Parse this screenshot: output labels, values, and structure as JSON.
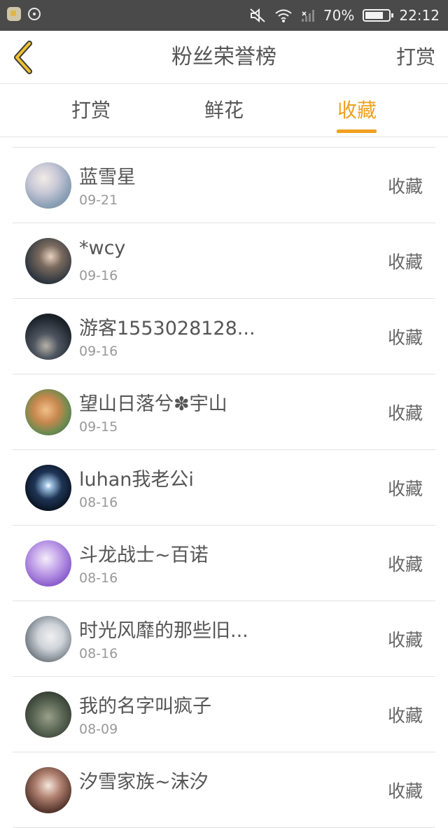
{
  "status_bar": {
    "battery": "70%",
    "time": "22:12"
  },
  "header": {
    "title": "粉丝荣誉榜",
    "action_label": "打赏"
  },
  "tabs": [
    {
      "label": "打赏",
      "active": false
    },
    {
      "label": "鲜花",
      "active": false
    },
    {
      "label": "收藏",
      "active": true
    }
  ],
  "accent_color": "#f0a020",
  "fans": [
    {
      "name": "蓝雪星",
      "date": "09-21",
      "action": "收藏"
    },
    {
      "name": "*wcy",
      "date": "09-16",
      "action": "收藏"
    },
    {
      "name": "游客1553028128...",
      "date": "09-16",
      "action": "收藏"
    },
    {
      "name": "望山日落兮✽宇山",
      "date": "09-15",
      "action": "收藏"
    },
    {
      "name": "luhan我老公i",
      "date": "08-16",
      "action": "收藏"
    },
    {
      "name": "斗龙战士~百诺",
      "date": "08-16",
      "action": "收藏"
    },
    {
      "name": "时光风靡的那些旧...",
      "date": "08-16",
      "action": "收藏"
    },
    {
      "name": "我的名字叫疯子",
      "date": "08-09",
      "action": "收藏"
    },
    {
      "name": "汐雪家族~沫汐",
      "date": "",
      "action": "收藏"
    }
  ]
}
